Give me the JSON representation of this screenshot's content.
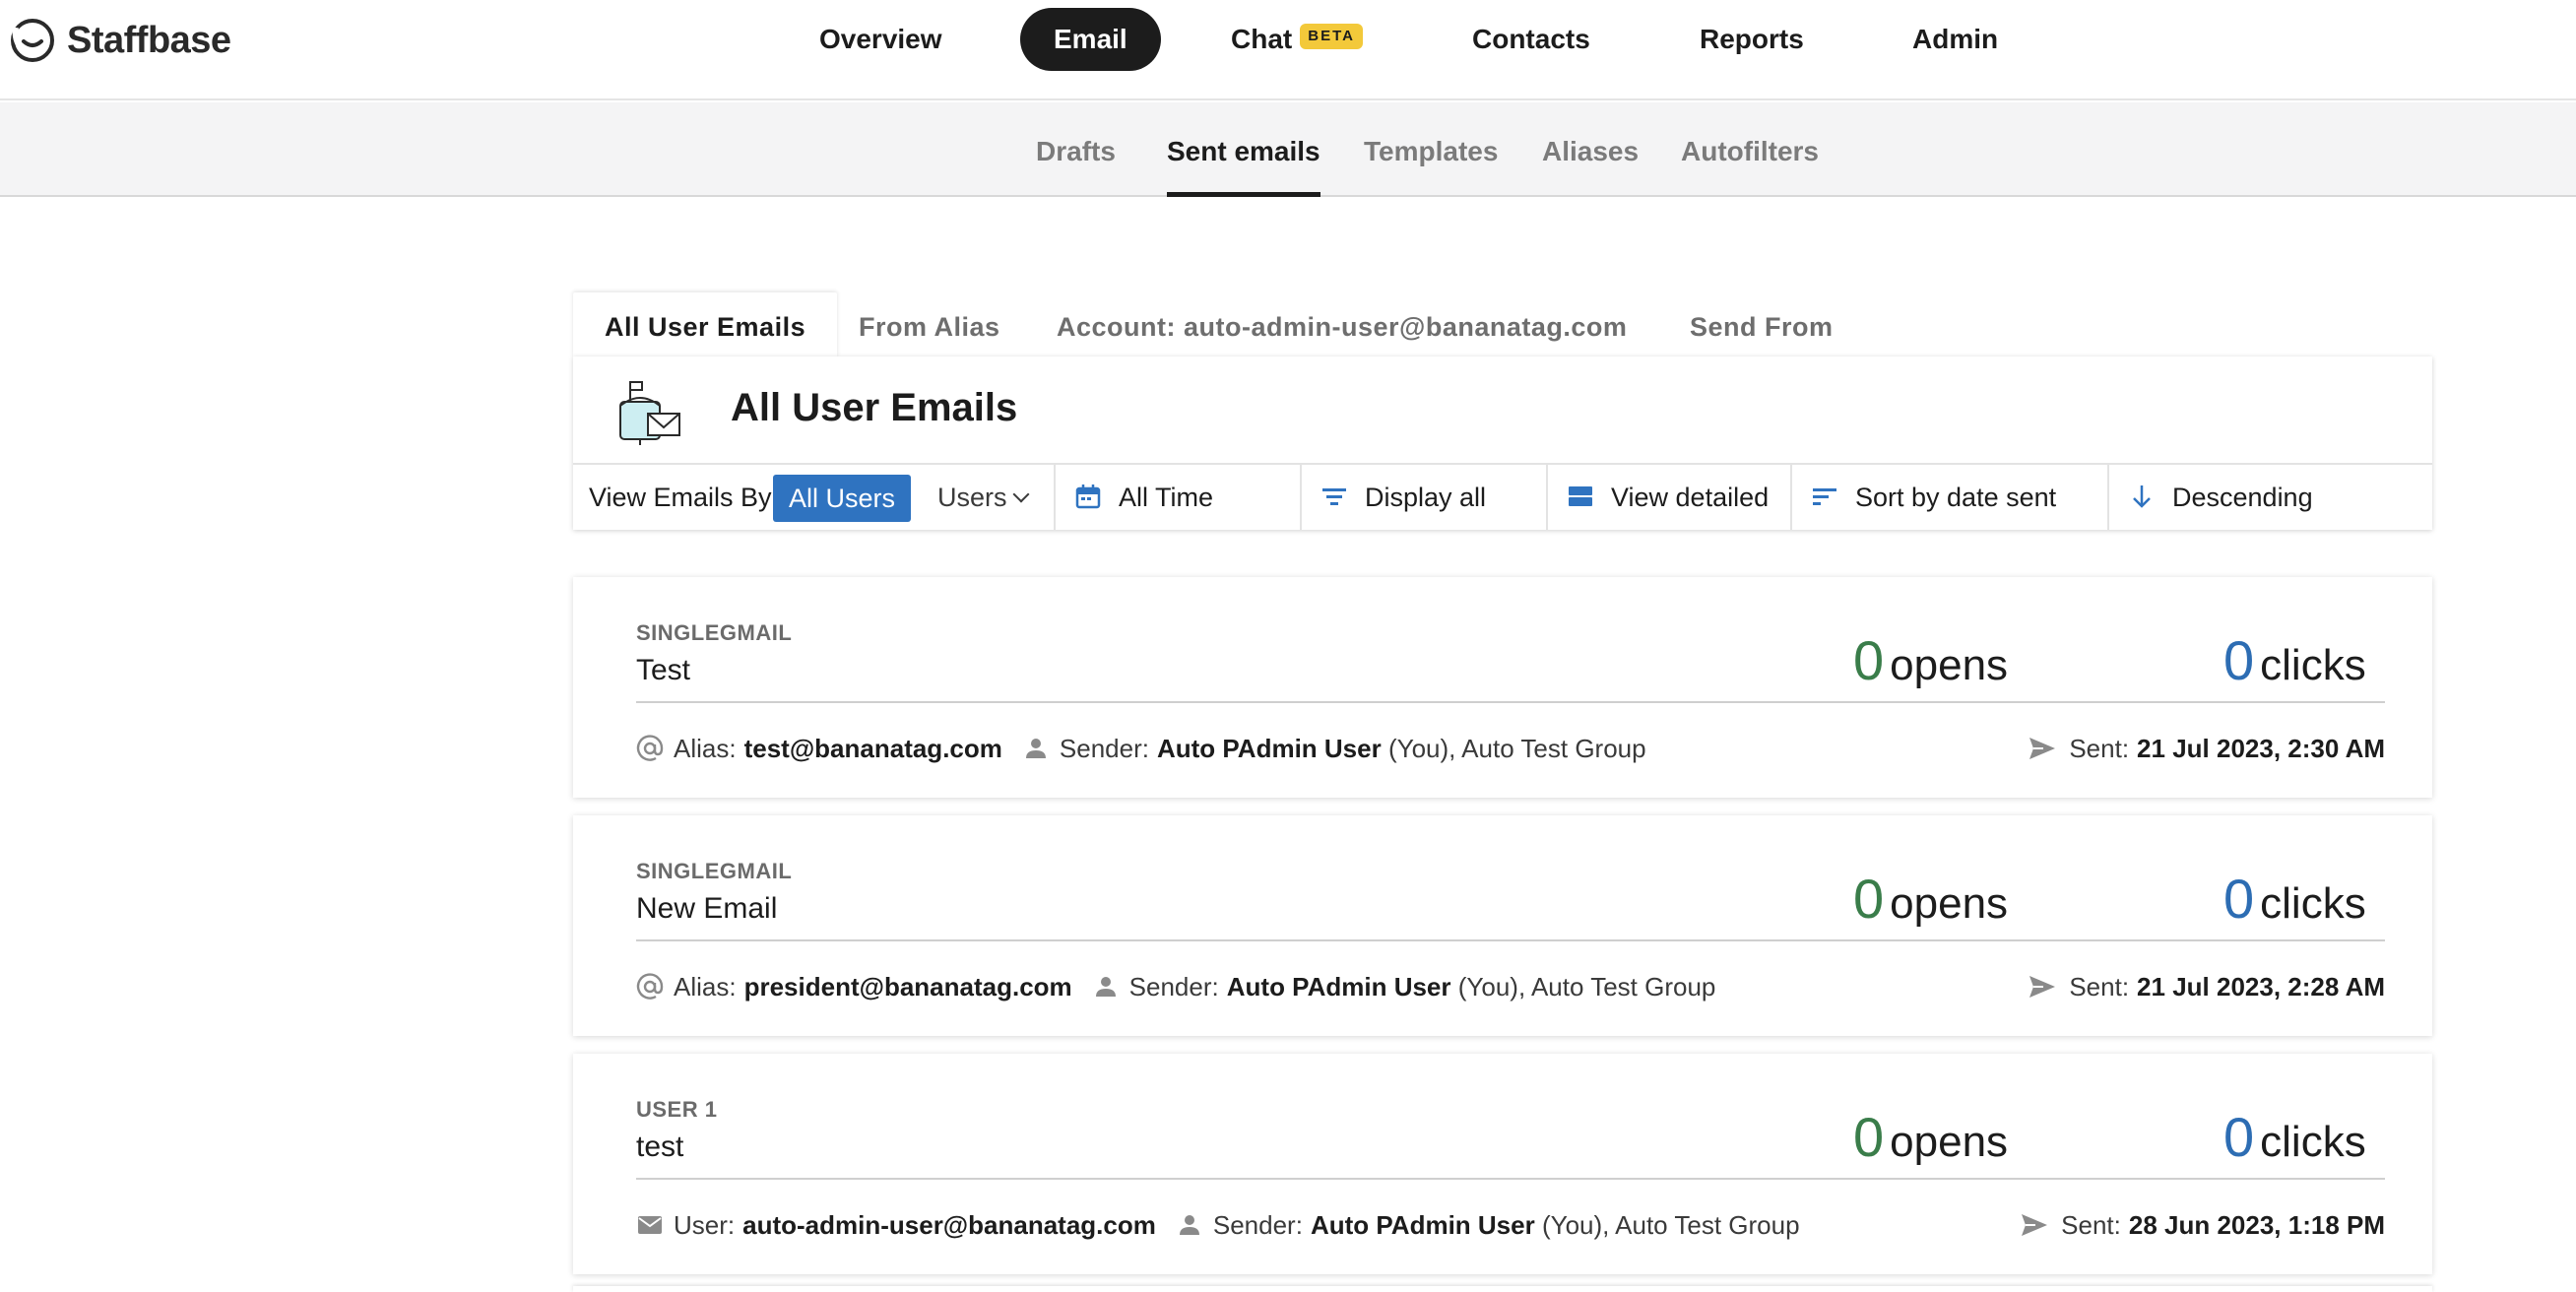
{
  "brand": {
    "name": "Staffbase"
  },
  "nav": {
    "items": [
      {
        "label": "Overview",
        "active": false
      },
      {
        "label": "Email",
        "active": true
      },
      {
        "label": "Chat",
        "active": false,
        "badge": "BETA"
      },
      {
        "label": "Contacts",
        "active": false
      },
      {
        "label": "Reports",
        "active": false
      },
      {
        "label": "Admin",
        "active": false
      }
    ]
  },
  "subnav": {
    "items": [
      {
        "label": "Drafts",
        "active": false
      },
      {
        "label": "Sent emails",
        "active": true
      },
      {
        "label": "Templates",
        "active": false
      },
      {
        "label": "Aliases",
        "active": false
      },
      {
        "label": "Autofilters",
        "active": false
      }
    ]
  },
  "tabs": [
    {
      "label": "All User Emails",
      "active": true
    },
    {
      "label": "From Alias",
      "active": false
    },
    {
      "label": "Account: auto-admin-user@bananatag.com",
      "active": false
    },
    {
      "label": "Send From",
      "active": false
    }
  ],
  "panel": {
    "title": "All User Emails",
    "view_by_label": "View Emails By:",
    "all_users_label": "All Users",
    "users_dropdown_label": "Users",
    "filters": {
      "time": "All Time",
      "display": "Display all",
      "view": "View detailed",
      "sort": "Sort by date sent",
      "order": "Descending"
    }
  },
  "emails": [
    {
      "kind": "SINGLEGMAIL",
      "subject": "Test",
      "opens": "0",
      "opens_label": "opens",
      "clicks": "0",
      "clicks_label": "clicks",
      "source_label": "Alias:",
      "source_value": "test@bananatag.com",
      "sender_label": "Sender:",
      "sender_name": "Auto PAdmin User",
      "sender_suffix": "(You), Auto Test Group",
      "sent_label": "Sent:",
      "sent_value": "21 Jul 2023, 2:30 AM"
    },
    {
      "kind": "SINGLEGMAIL",
      "subject": "New Email",
      "opens": "0",
      "opens_label": "opens",
      "clicks": "0",
      "clicks_label": "clicks",
      "source_label": "Alias:",
      "source_value": "president@bananatag.com",
      "sender_label": "Sender:",
      "sender_name": "Auto PAdmin User",
      "sender_suffix": "(You), Auto Test Group",
      "sent_label": "Sent:",
      "sent_value": "21 Jul 2023, 2:28 AM"
    },
    {
      "kind": "USER 1",
      "subject": "test",
      "opens": "0",
      "opens_label": "opens",
      "clicks": "0",
      "clicks_label": "clicks",
      "source_label": "User:",
      "source_value": "auto-admin-user@bananatag.com",
      "sender_label": "Sender:",
      "sender_name": "Auto PAdmin User",
      "sender_suffix": "(You), Auto Test Group",
      "sent_label": "Sent:",
      "sent_value": "28 Jun 2023, 1:18 PM"
    }
  ],
  "colors": {
    "opens": "#3a7d4a",
    "clicks": "#2d6db3",
    "primary_button": "#2f73c0",
    "beta_badge": "#f3c93a"
  }
}
